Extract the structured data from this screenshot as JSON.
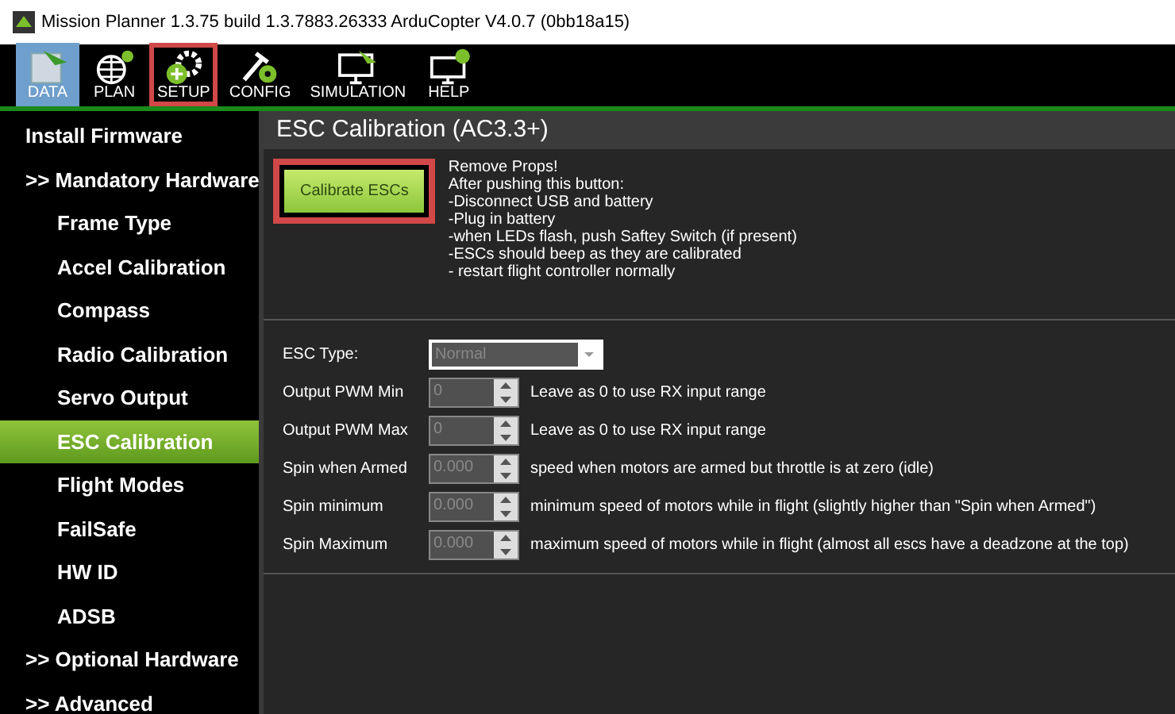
{
  "window": {
    "title": "Mission Planner 1.3.75 build 1.3.7883.26333 ArduCopter V4.0.7 (0bb18a15)"
  },
  "toolbar": [
    {
      "label": "DATA",
      "kind": "data",
      "selected": true,
      "highlighted": false
    },
    {
      "label": "PLAN",
      "kind": "plan",
      "selected": false,
      "highlighted": false
    },
    {
      "label": "SETUP",
      "kind": "setup",
      "selected": false,
      "highlighted": true
    },
    {
      "label": "CONFIG",
      "kind": "config",
      "selected": false,
      "highlighted": false
    },
    {
      "label": "SIMULATION",
      "kind": "simulation",
      "selected": false,
      "highlighted": false
    },
    {
      "label": "HELP",
      "kind": "help",
      "selected": false,
      "highlighted": false
    }
  ],
  "sidebar": {
    "items": [
      {
        "label": "Install Firmware",
        "selected": false
      },
      {
        "label": ">> Mandatory Hardware",
        "selected": false,
        "children": [
          {
            "label": "Frame Type",
            "selected": false
          },
          {
            "label": "Accel Calibration",
            "selected": false
          },
          {
            "label": "Compass",
            "selected": false
          },
          {
            "label": "Radio Calibration",
            "selected": false
          },
          {
            "label": "Servo Output",
            "selected": false
          },
          {
            "label": "ESC Calibration",
            "selected": true
          },
          {
            "label": "Flight Modes",
            "selected": false
          },
          {
            "label": "FailSafe",
            "selected": false
          },
          {
            "label": "HW ID",
            "selected": false
          },
          {
            "label": "ADSB",
            "selected": false
          }
        ]
      },
      {
        "label": ">> Optional Hardware",
        "selected": false
      },
      {
        "label": ">> Advanced",
        "selected": false
      }
    ]
  },
  "page": {
    "title": "ESC Calibration (AC3.3+)",
    "calibrate_button": {
      "label": "Calibrate ESCs",
      "highlighted": true
    },
    "instructions": [
      "Remove Props!",
      "After pushing this button:",
      "-Disconnect USB and battery",
      "-Plug in battery",
      "-when LEDs flash, push Saftey Switch (if present)",
      "-ESCs should beep as they are calibrated",
      "- restart flight controller normally"
    ],
    "form": [
      {
        "kind": "dropdown",
        "label": "ESC Type:",
        "value": "Normal"
      },
      {
        "kind": "spinner",
        "label": "Output PWM Min",
        "value": "0",
        "hint": "Leave as 0 to use RX input range"
      },
      {
        "kind": "spinner",
        "label": "Output PWM Max",
        "value": "0",
        "hint": "Leave as 0 to use RX input range"
      },
      {
        "kind": "spinner",
        "label": "Spin when Armed",
        "value": "0.000",
        "hint": "speed when motors are armed but throttle is at zero (idle)"
      },
      {
        "kind": "spinner",
        "label": "Spin minimum",
        "value": "0.000",
        "hint": "minimum speed of motors while in flight (slightly higher than \"Spin when Armed\")"
      },
      {
        "kind": "spinner",
        "label": "Spin Maximum",
        "value": "0.000",
        "hint": "maximum speed of motors while in flight (almost all escs have a deadzone at the top)"
      }
    ]
  }
}
